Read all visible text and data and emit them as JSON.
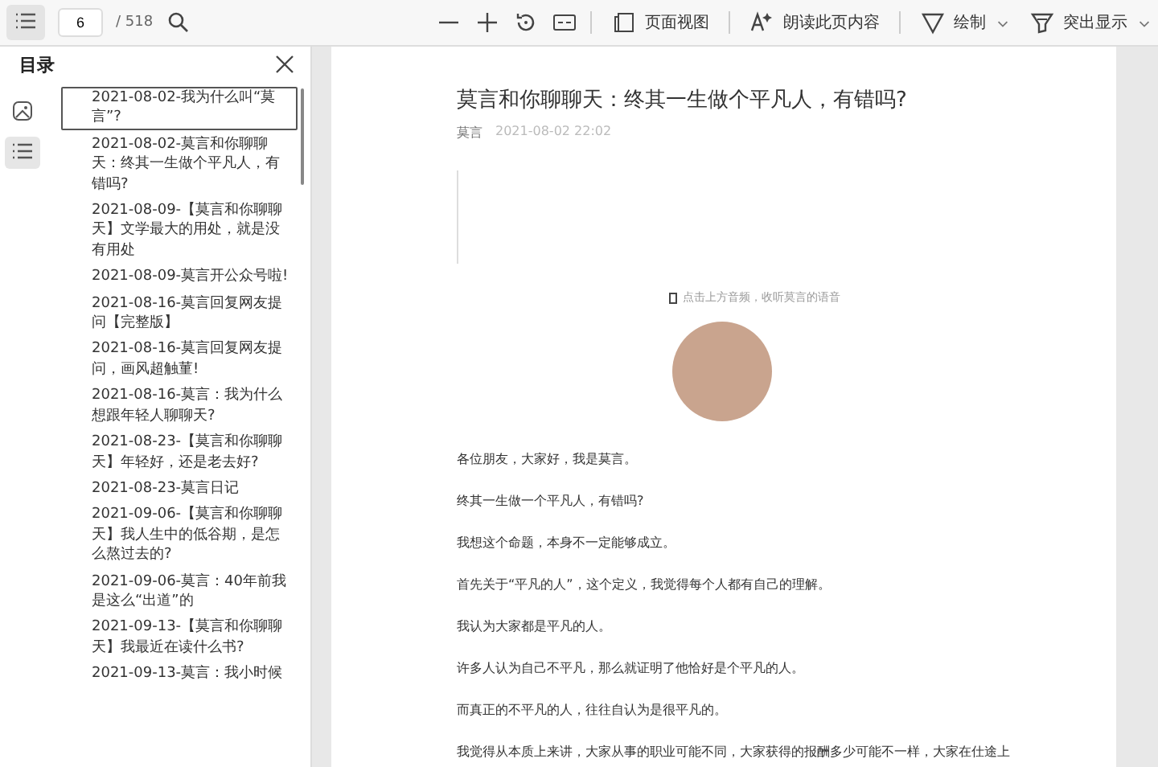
{
  "toolbar": {
    "page": "6",
    "page_total": "/ 518",
    "tools": [
      {
        "kind": "icon"
      },
      {
        "kind": "icon"
      },
      {
        "kind": "icon"
      },
      {
        "kind": "icon"
      },
      {
        "kind": "sep"
      },
      {
        "kind": "label",
        "label": "页面视图"
      },
      {
        "kind": "sep"
      },
      {
        "kind": "label",
        "label": "朗读此页内容"
      },
      {
        "kind": "sep"
      },
      {
        "kind": "menu",
        "label": "绘制"
      },
      {
        "kind": "menu",
        "label": "突出显示"
      }
    ]
  },
  "sidebar": {
    "title": "目录",
    "tabs": [
      {
        "selected": false
      },
      {
        "selected": true
      }
    ],
    "items": [
      {
        "label": "2021-08-02-我为什么叫“莫言”?",
        "selected": true
      },
      {
        "label": "2021-08-02-莫言和你聊聊天：终其一生做个平凡人，有错吗?",
        "selected": false
      },
      {
        "label": "2021-08-09-【莫言和你聊聊天】文学最大的用处，就是没有用处",
        "selected": false
      },
      {
        "label": "2021-08-09-莫言开公众号啦!",
        "selected": false
      },
      {
        "label": "2021-08-16-莫言回复网友提问【完整版】",
        "selected": false
      },
      {
        "label": "2021-08-16-莫言回复网友提问，画风超触菫!",
        "selected": false
      },
      {
        "label": "2021-08-16-莫言：我为什么想跟年轻人聊聊天?",
        "selected": false
      },
      {
        "label": "2021-08-23-【莫言和你聊聊天】年轻好，还是老去好?",
        "selected": false
      },
      {
        "label": "2021-08-23-莫言日记",
        "selected": false
      },
      {
        "label": "2021-09-06-【莫言和你聊聊天】我人生中的低谷期，是怎么熬过去的?",
        "selected": false
      },
      {
        "label": "2021-09-06-莫言：40年前我是这么“出道”的",
        "selected": false
      },
      {
        "label": "2021-09-13-【莫言和你聊聊天】我最近在读什么书?",
        "selected": false
      },
      {
        "label": "2021-09-13-莫言：我小时候",
        "selected": false
      }
    ]
  },
  "document": {
    "title": "莫言和你聊聊天：终其一生做个平凡人，有错吗?",
    "author": "莫言",
    "date": "2021-08-02 22:02",
    "caption": "点击上方音频，收听莫言的语音",
    "paragraphs": [
      "各位朋友，大家好，我是莫言。",
      "终其一生做一个平凡人，有错吗?",
      "我想这个命题，本身不一定能够成立。",
      "首先关于“平凡的人”，这个定义，我觉得每个人都有自己的理解。",
      "我认为大家都是平凡的人。",
      "许多人认为自己不平凡，那么就证明了他恰好是个平凡的人。",
      "而真正的不平凡的人，往往自认为是很平凡的。",
      "我觉得从本质上来讲，大家从事的职业可能不同，大家获得的报酬多少可能不一样，大家在仕途上"
    ]
  }
}
